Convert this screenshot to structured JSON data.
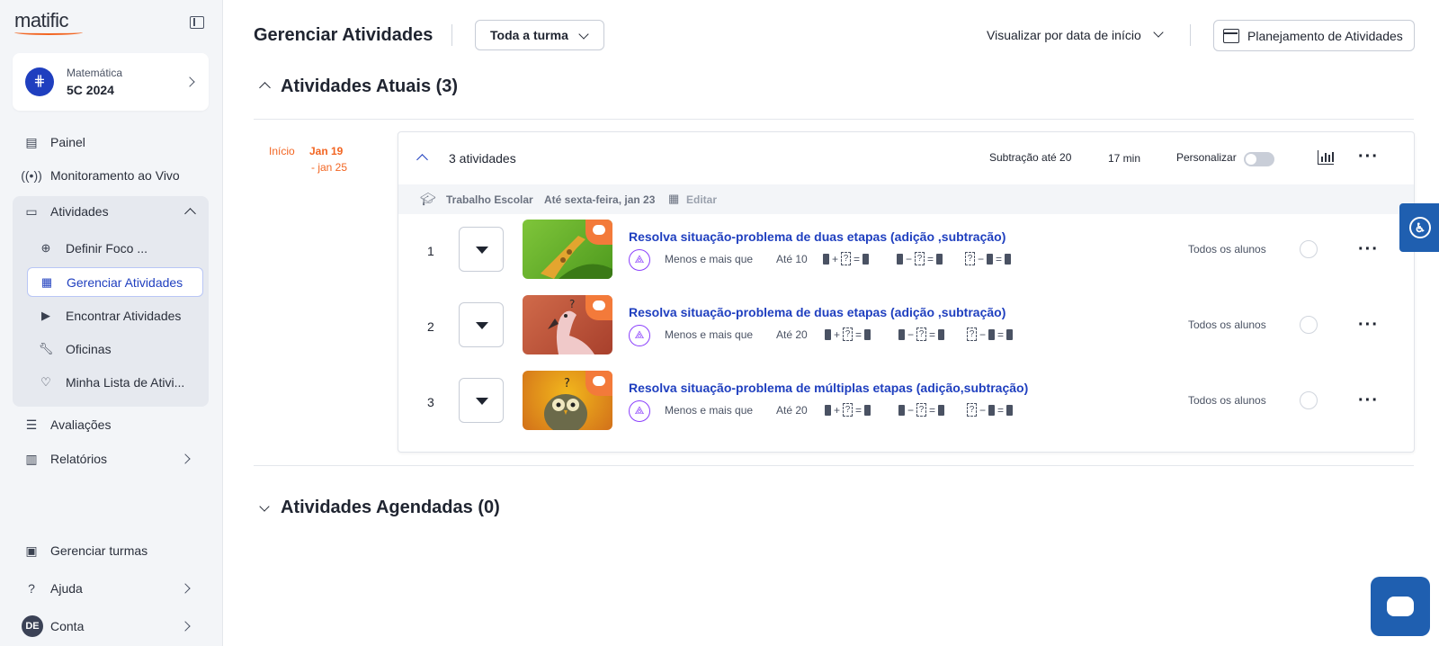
{
  "brand": {
    "logo": "matific"
  },
  "class_card": {
    "subject": "Matemática",
    "name": "5C 2024",
    "badge": "⋕"
  },
  "nav": {
    "painel": "Painel",
    "monitoramento": "Monitoramento ao Vivo",
    "atividades": "Atividades",
    "sub": {
      "definir_foco": "Definir Foco ...",
      "gerenciar": "Gerenciar Atividades",
      "encontrar": "Encontrar Atividades",
      "oficinas": "Oficinas",
      "minha_lista": "Minha Lista de Ativi..."
    },
    "avaliacoes": "Avaliações",
    "relatorios": "Relatórios",
    "gerenciar_turmas": "Gerenciar turmas",
    "ajuda": "Ajuda",
    "conta": "Conta",
    "avatar_initials": "DE"
  },
  "header": {
    "title": "Gerenciar Atividades",
    "class_filter": "Toda a turma",
    "view_by": "Visualizar por data de início",
    "planning_button": "Planejamento de Atividades"
  },
  "current": {
    "title": "Atividades Atuais (3)",
    "start_label": "Início",
    "start_date": "Jan 19",
    "end_date": "- jan 25",
    "group": {
      "count": "3 atividades",
      "topic": "Subtração até 20",
      "duration": "17 min",
      "personalize": "Personalizar",
      "personalize_on": false,
      "type": "Trabalho Escolar",
      "due": "Até sexta-feira, jan 23",
      "edit": "Editar"
    },
    "activities": [
      {
        "num": "1",
        "title": "Resolva situação-problema de duas etapas (adição ,subtração)",
        "skill": "Menos e mais que",
        "range": "Até 10",
        "audience": "Todos os alunos"
      },
      {
        "num": "2",
        "title": "Resolva situação-problema de duas etapas (adição ,subtração)",
        "skill": "Menos e mais que",
        "range": "Até 20",
        "audience": "Todos os alunos"
      },
      {
        "num": "3",
        "title": "Resolva situação-problema de múltiplas etapas (adição,subtração)",
        "skill": "Menos e mais que",
        "range": "Até 20",
        "audience": "Todos os alunos"
      }
    ],
    "equation_symbols": {
      "plus": "+",
      "minus": "−",
      "equals": "=",
      "unknown": "?"
    }
  },
  "scheduled": {
    "title": "Atividades Agendadas (0)"
  },
  "colors": {
    "accent": "#1f3fbf",
    "orange": "#f26522",
    "floating": "#1f5fb0",
    "share": "#8a3ffc"
  }
}
